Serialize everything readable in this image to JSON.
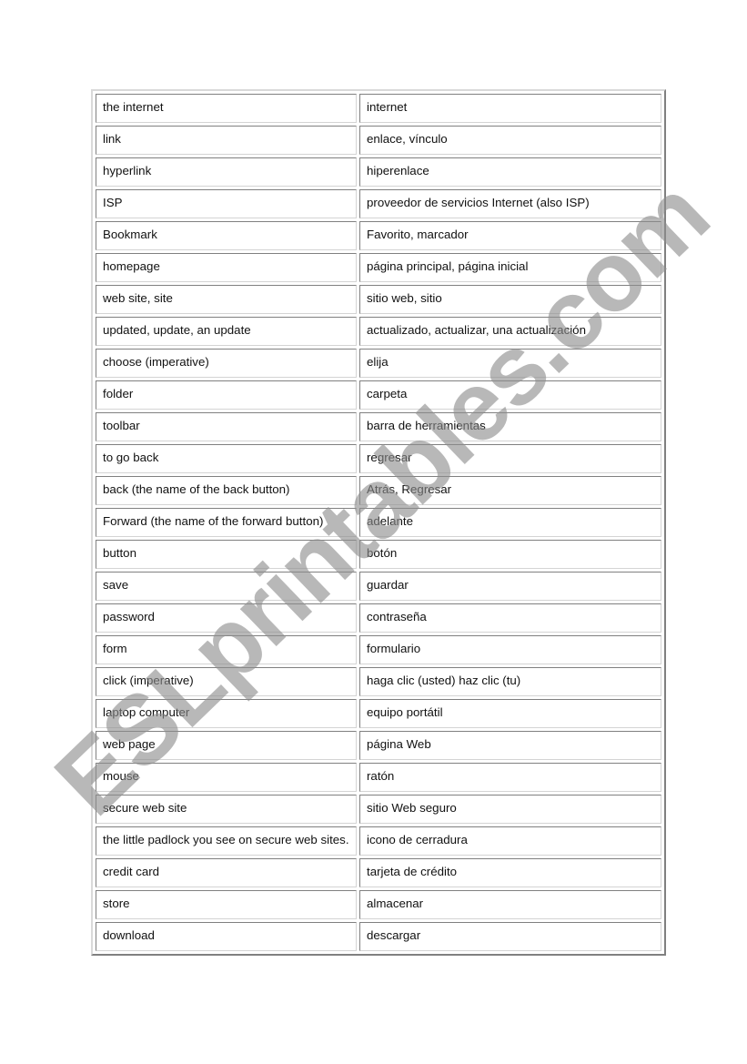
{
  "watermark": "ESLprintables.com",
  "rows": [
    {
      "en": "the internet",
      "es": "internet"
    },
    {
      "en": "link",
      "es": "enlace, vínculo"
    },
    {
      "en": "hyperlink",
      "es": "hiperenlace"
    },
    {
      "en": "ISP",
      "es": "proveedor de servicios Internet (also ISP)"
    },
    {
      "en": "Bookmark",
      "es": "Favorito, marcador"
    },
    {
      "en": "homepage",
      "es": "página principal, página inicial"
    },
    {
      "en": "web site, site",
      "es": "sitio web, sitio"
    },
    {
      "en": "updated, update, an update",
      "es": "actualizado, actualizar, una actualización"
    },
    {
      "en": "choose (imperative)",
      "es": "elija"
    },
    {
      "en": "folder",
      "es": "carpeta"
    },
    {
      "en": "toolbar",
      "es": "barra de herramientas"
    },
    {
      "en": "to go back",
      "es": "regresar"
    },
    {
      "en": "back (the name of the back button)",
      "es": "Atrás, Regresar"
    },
    {
      "en": "Forward (the name of the forward button)",
      "es": "adelante"
    },
    {
      "en": "button",
      "es": "botón"
    },
    {
      "en": "save",
      "es": "guardar"
    },
    {
      "en": "password",
      "es": "contraseña"
    },
    {
      "en": "form",
      "es": "formulario"
    },
    {
      "en": "click (imperative)",
      "es": "haga clic (usted) haz clic (tu)"
    },
    {
      "en": "laptop computer",
      "es": "equipo portátil"
    },
    {
      "en": "web page",
      "es": "página Web"
    },
    {
      "en": "mouse",
      "es": "ratón"
    },
    {
      "en": "secure web site",
      "es": "sitio Web seguro"
    },
    {
      "en": "the little padlock you see on secure web sites.",
      "es": "icono de cerradura"
    },
    {
      "en": "credit card",
      "es": "tarjeta de crédito"
    },
    {
      "en": "store",
      "es": "almacenar"
    },
    {
      "en": "download",
      "es": "descargar"
    }
  ]
}
